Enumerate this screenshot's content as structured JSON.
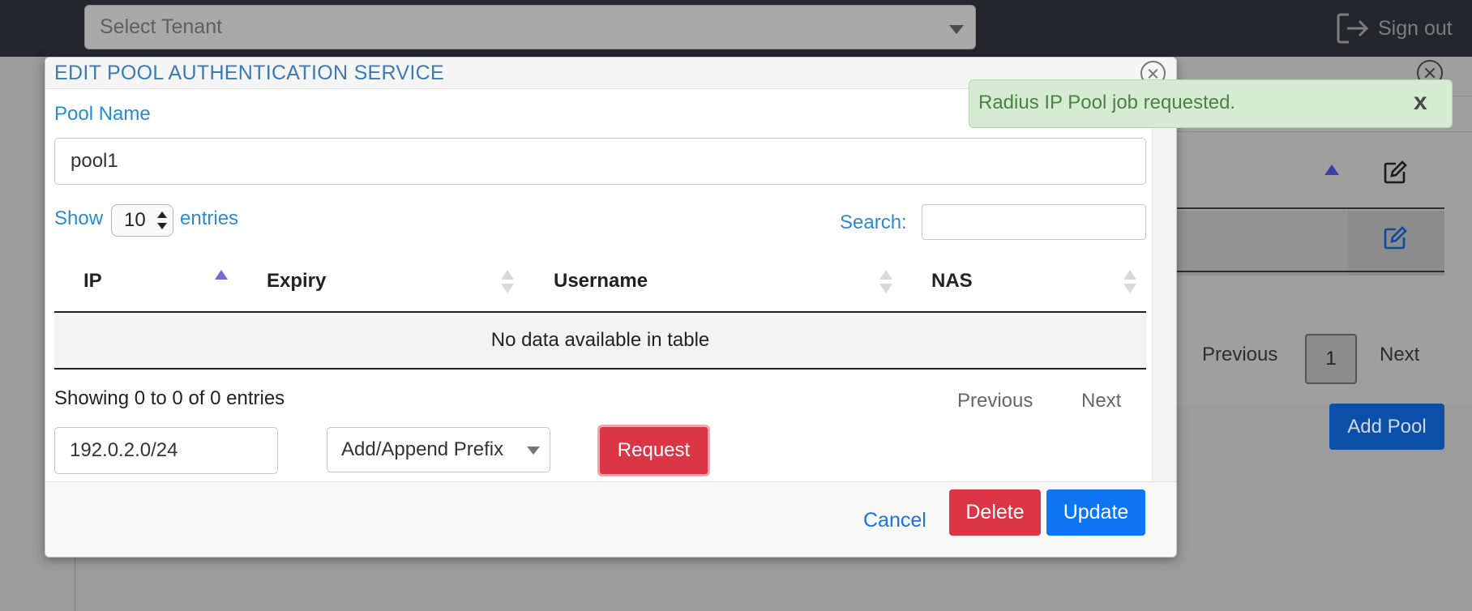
{
  "topbar": {
    "tenant_placeholder": "Select Tenant",
    "sign_out_label": "Sign out"
  },
  "background": {
    "pagination": {
      "previous": "Previous",
      "page": "1",
      "next": "Next"
    },
    "add_pool_label": "Add Pool"
  },
  "modal": {
    "title": "EDIT POOL AUTHENTICATION SERVICE",
    "pool_name_label": "Pool Name",
    "pool_name_value": "pool1",
    "show_label": "Show",
    "entries_value": "10",
    "entries_label": "entries",
    "search_label": "Search:",
    "search_value": "",
    "table": {
      "columns": [
        "IP",
        "Expiry",
        "Username",
        "NAS"
      ],
      "sorted_column": "IP",
      "empty_message": "No data available in table"
    },
    "info": "Showing 0 to 0 of 0 entries",
    "pagination": {
      "previous": "Previous",
      "next": "Next"
    },
    "prefix_value": "192.0.2.0/24",
    "action_select_value": "Add/Append Prefix",
    "request_label": "Request",
    "footer": {
      "cancel": "Cancel",
      "delete": "Delete",
      "update": "Update"
    }
  },
  "toast": {
    "message": "Radius IP Pool job requested.",
    "close_label": "x"
  },
  "colors": {
    "topbar_bg": "#23262b",
    "title_blue": "#3a7bb5",
    "label_blue": "#2a8bd0",
    "danger": "#dc3545",
    "primary": "#0d74f2",
    "toast_bg": "#d5ecd2",
    "toast_text": "#4d7f46"
  },
  "icons": [
    "sign-out-icon",
    "close-icon",
    "sort-asc-icon",
    "sort-both-icon",
    "edit-icon",
    "caret-down-icon"
  ]
}
